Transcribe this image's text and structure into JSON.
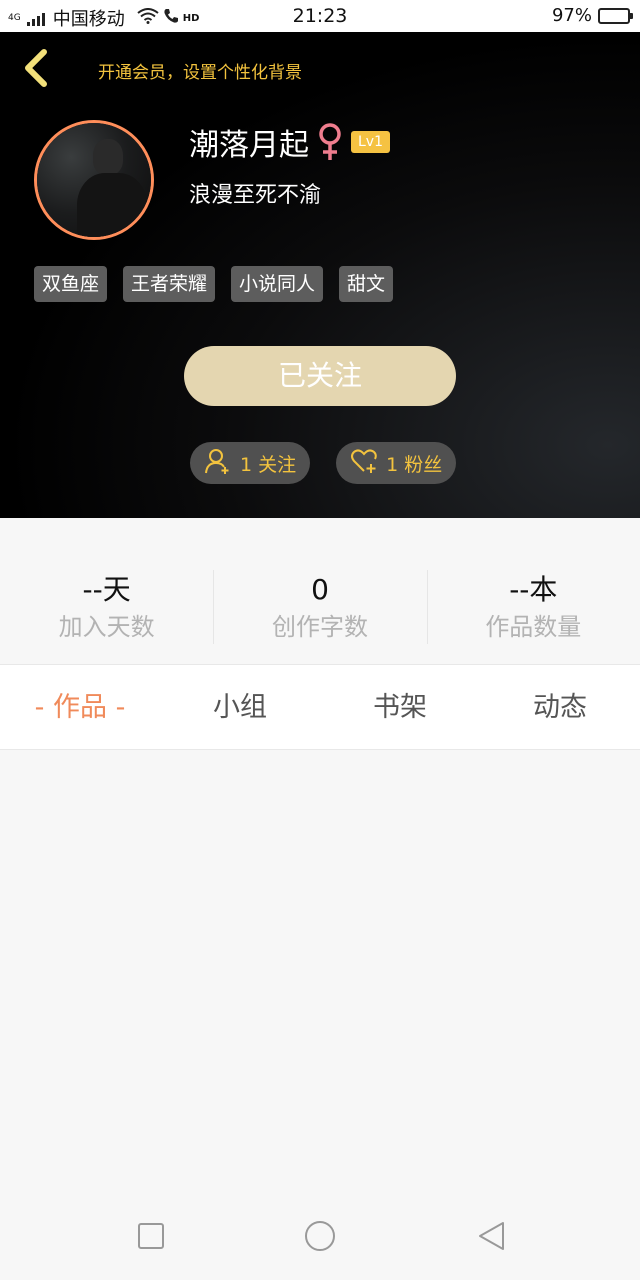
{
  "status_bar": {
    "network": "4G",
    "carrier": "中国移动",
    "hd": "HD",
    "time": "21:23",
    "battery": "97%",
    "battery_level": 0.97
  },
  "header": {
    "vip_link": "开通会员，设置个性化背景",
    "back_icon": "chevron-left-icon"
  },
  "profile": {
    "name": "潮落月起",
    "gender_icon": "female-symbol-icon",
    "level": "Lv1",
    "signature": "浪漫至死不渝",
    "tags": [
      "双鱼座",
      "王者荣耀",
      "小说同人",
      "甜文"
    ],
    "follow_button": "已关注",
    "following": "1 关注",
    "fans": "1 粉丝"
  },
  "stats": [
    {
      "value": "--天",
      "label": "加入天数"
    },
    {
      "value": "0",
      "label": "创作字数"
    },
    {
      "value": "--本",
      "label": "作品数量"
    }
  ],
  "tabs": [
    {
      "label": "- 作品 -",
      "active": true
    },
    {
      "label": "小组",
      "active": false
    },
    {
      "label": "书架",
      "active": false
    },
    {
      "label": "动态",
      "active": false
    }
  ],
  "colors": {
    "accent": "#f08a5a",
    "gold": "#f3c33e",
    "follow_button": "#e4d6b0",
    "avatar_ring": "#ff8e5a",
    "gender": "#ef7d8e"
  }
}
